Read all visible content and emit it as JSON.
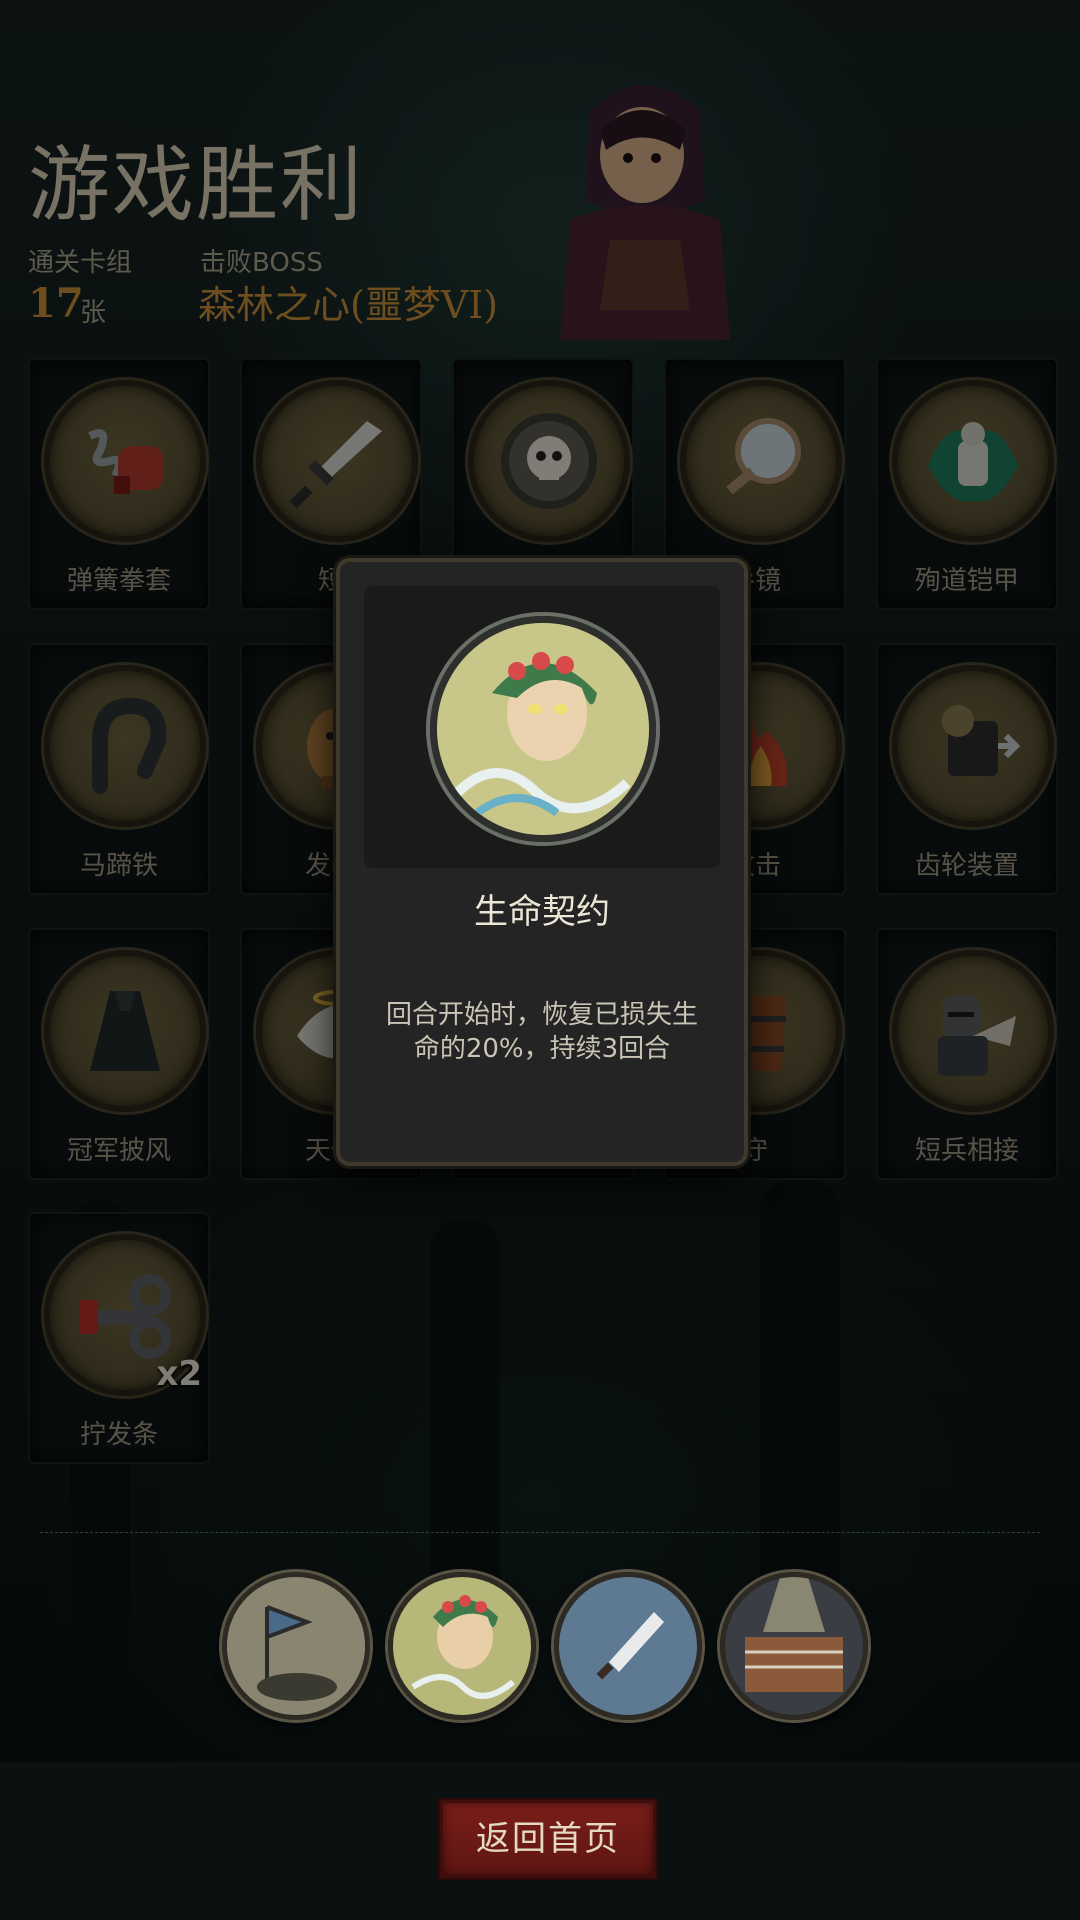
{
  "header": {
    "title": "游戏胜利",
    "deck_label": "通关卡组",
    "deck_count": "17",
    "deck_unit": "张",
    "boss_label": "击败BOSS",
    "boss_name": "森林之心(噩梦VI)"
  },
  "cards": [
    {
      "label": "弹簧拳套",
      "icon": "spring-glove-icon"
    },
    {
      "label": "短",
      "icon": "short-sword-icon"
    },
    {
      "label": "",
      "icon": "skull-shield-icon"
    },
    {
      "label": "手镜",
      "icon": "hand-mirror-icon"
    },
    {
      "label": "殉道铠甲",
      "icon": "martyr-armor-icon"
    },
    {
      "label": "马蹄铁",
      "icon": "horseshoe-icon"
    },
    {
      "label": "发条",
      "icon": "wooden-horse-icon"
    },
    {
      "label": "",
      "icon": "hidden-card-icon"
    },
    {
      "label": "攻击",
      "icon": "flame-attack-icon"
    },
    {
      "label": "齿轮装置",
      "icon": "gear-device-icon"
    },
    {
      "label": "冠军披风",
      "icon": "champion-cloak-icon"
    },
    {
      "label": "天使",
      "icon": "angel-wing-icon"
    },
    {
      "label": "",
      "icon": "hidden-card-icon"
    },
    {
      "label": "守",
      "icon": "barrel-shield-icon"
    },
    {
      "label": "短兵相接",
      "icon": "knight-icon"
    },
    {
      "label": "拧发条",
      "icon": "wind-up-key-icon",
      "badge": "x2"
    }
  ],
  "modal": {
    "title": "生命契约",
    "description": "回合开始时，恢复已损失生命的20%，持续3回合",
    "icon": "dryad-portrait-icon"
  },
  "relics": [
    {
      "icon": "battle-banner-icon"
    },
    {
      "icon": "dryad-portrait-icon"
    },
    {
      "icon": "dagger-icon"
    },
    {
      "icon": "boxing-ring-icon"
    }
  ],
  "footer": {
    "home_label": "返回首页"
  },
  "colors": {
    "accent_gold": "#c88f3a",
    "button_red": "#7a1e1a",
    "background": "#0d1414"
  }
}
